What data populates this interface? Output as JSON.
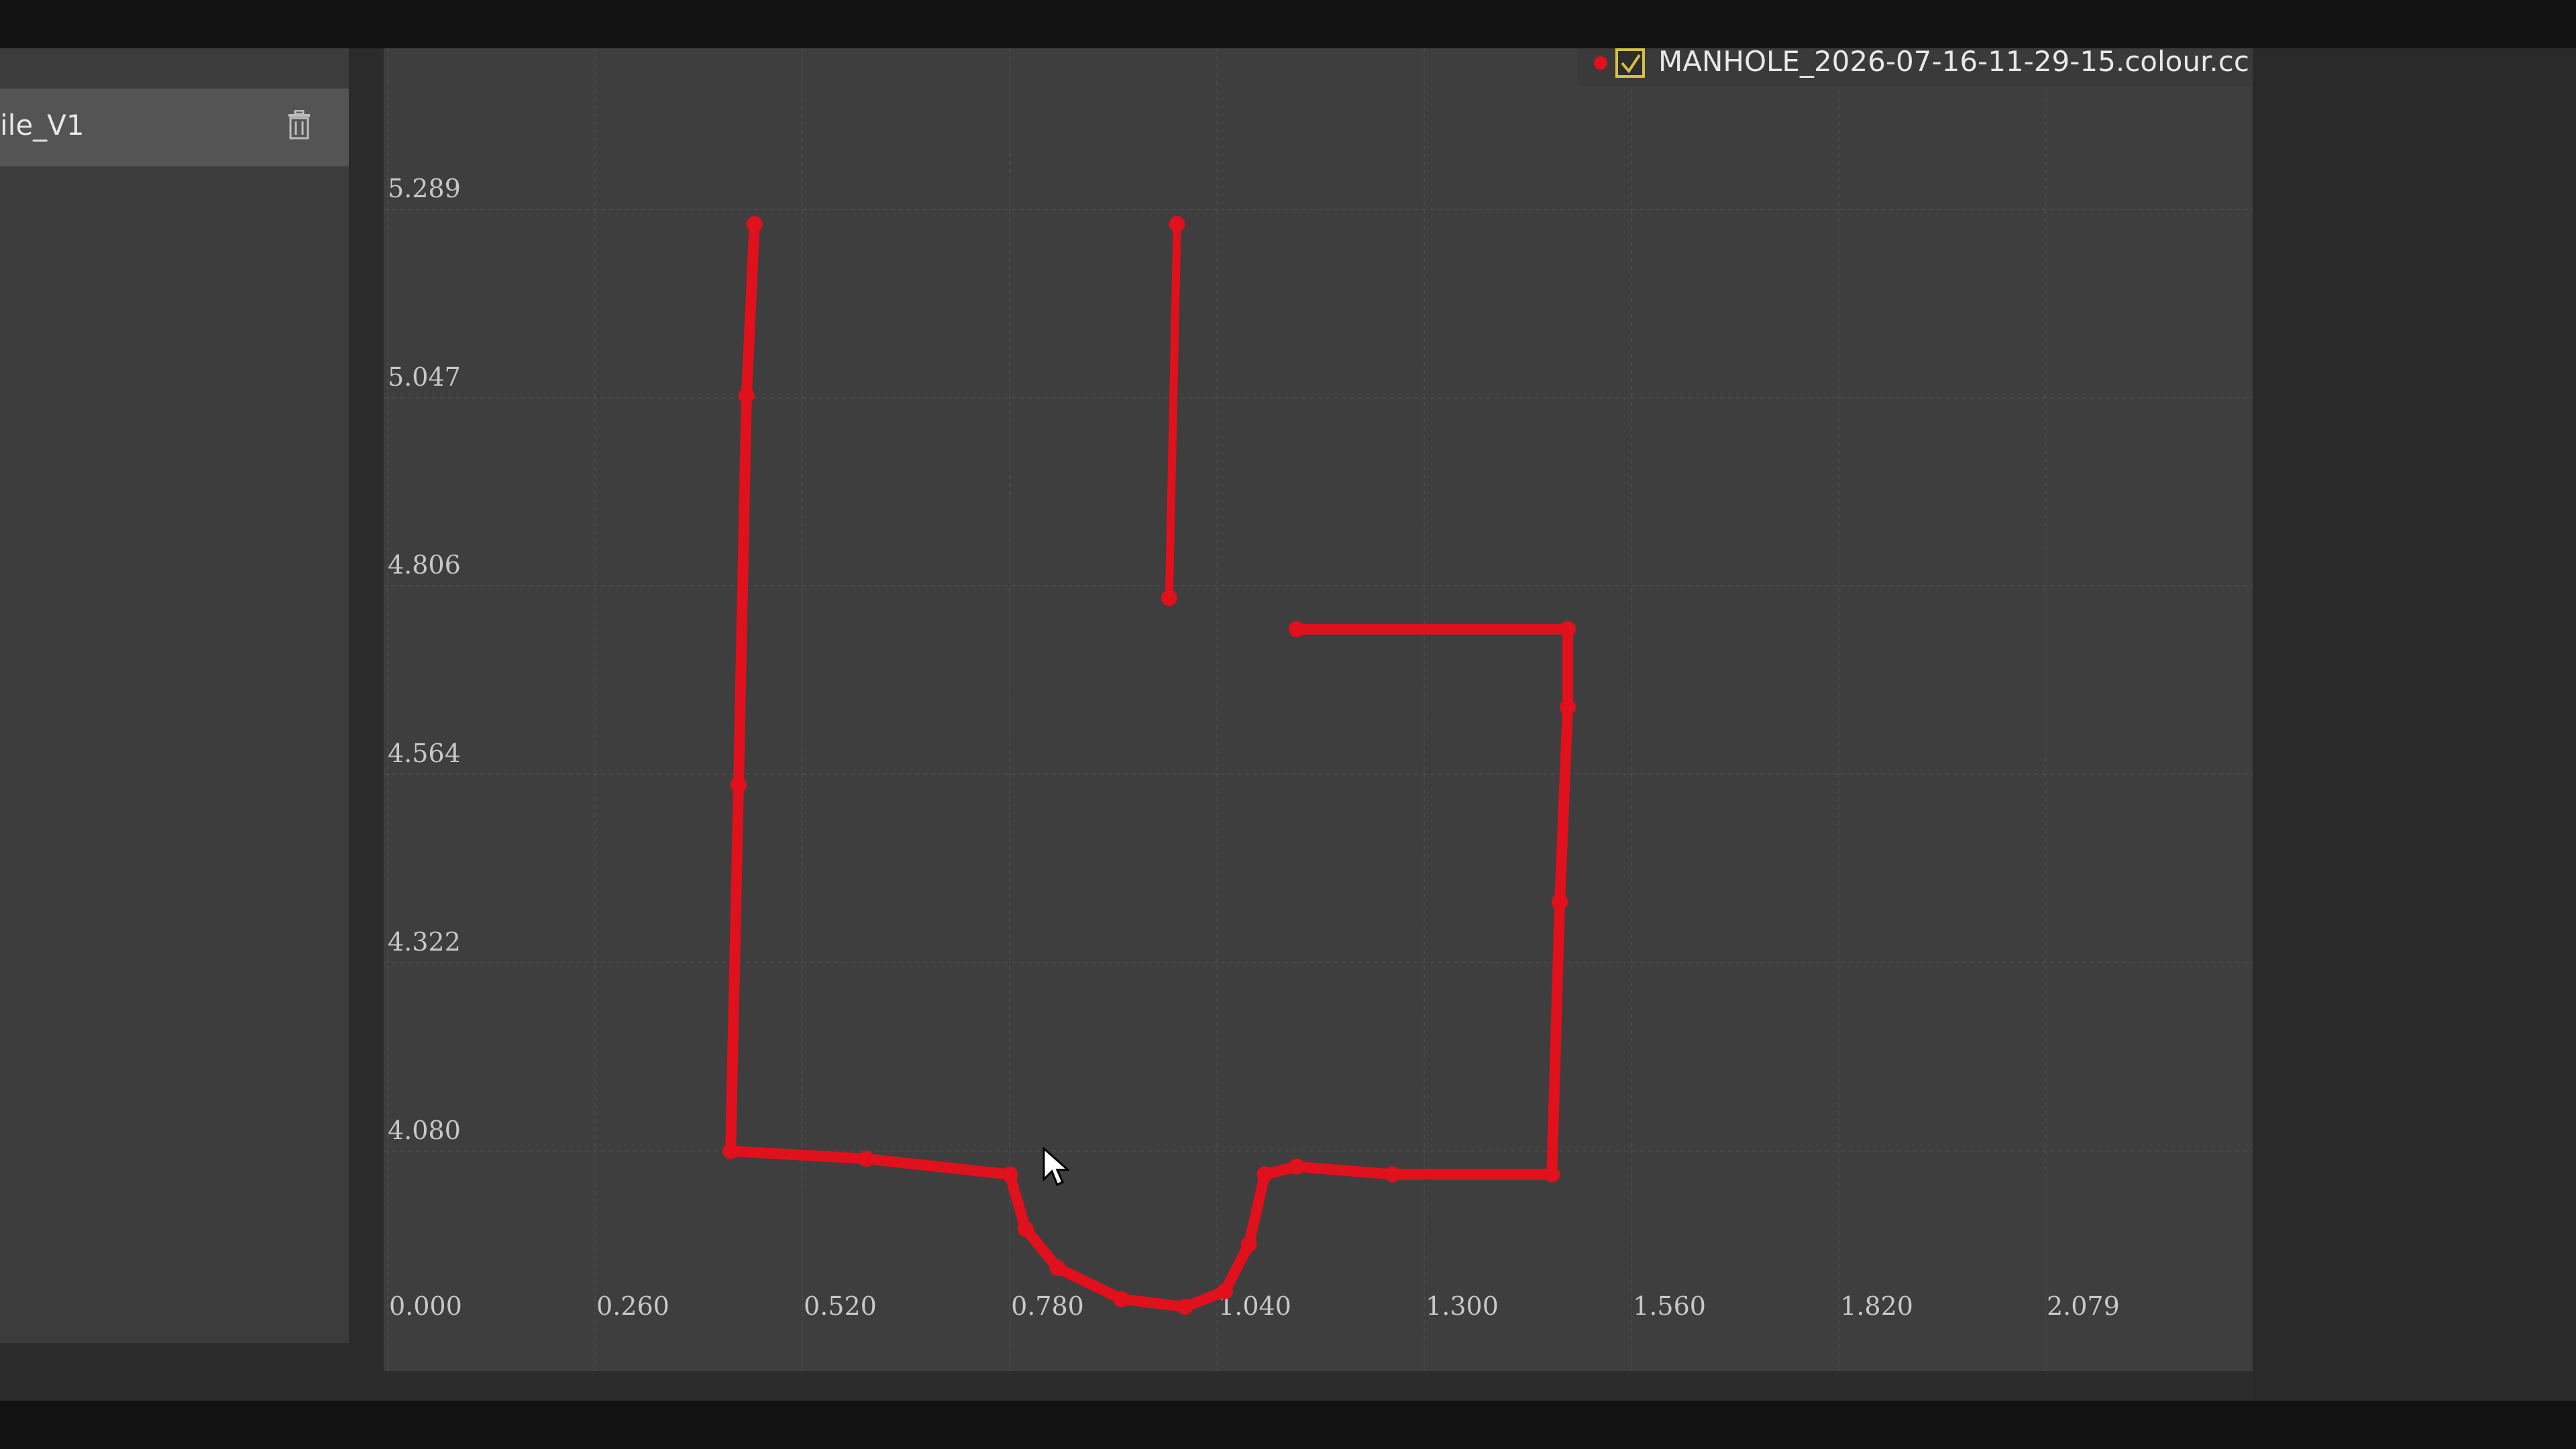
{
  "sidebar": {
    "layer_name": "ile_V1",
    "delete_icon": "trash-icon"
  },
  "legend": {
    "label": "MANHOLE_2026-07-16-11-29-15.colour.cc",
    "checked": true,
    "marker_color": "#e0101c"
  },
  "chart_data": {
    "type": "scatter",
    "title": "",
    "xlabel": "",
    "ylabel": "",
    "series": [
      {
        "name": "MANHOLE_2026-07-16-11-29-15.colour.cc",
        "color": "#e0101c",
        "x": [
          0.46,
          0.45,
          0.44,
          0.43,
          0.6,
          0.78,
          0.8,
          0.84,
          0.92,
          1.0,
          1.05,
          1.08,
          1.1,
          1.14,
          1.26,
          1.46,
          1.47,
          1.48,
          1.48,
          1.14,
          0.99,
          0.98
        ],
        "y": [
          5.27,
          5.05,
          4.55,
          4.08,
          4.07,
          4.05,
          3.98,
          3.93,
          3.89,
          3.88,
          3.9,
          3.96,
          4.05,
          4.06,
          4.05,
          4.05,
          4.4,
          4.65,
          4.75,
          4.75,
          5.27,
          4.79
        ]
      }
    ],
    "x_ticks": [
      "0.000",
      "0.260",
      "0.520",
      "0.780",
      "1.040",
      "1.300",
      "1.560",
      "1.820",
      "2.079"
    ],
    "y_ticks": [
      "5.289",
      "5.047",
      "4.806",
      "4.564",
      "4.322",
      "4.080"
    ],
    "xlim": [
      0.0,
      2.3
    ],
    "ylim": [
      3.78,
      5.32
    ],
    "grid": true,
    "legend_position": "top-right"
  },
  "colors": {
    "plot_background": "#3e3e3e",
    "grid": "#555555",
    "series": "#e0101c"
  }
}
